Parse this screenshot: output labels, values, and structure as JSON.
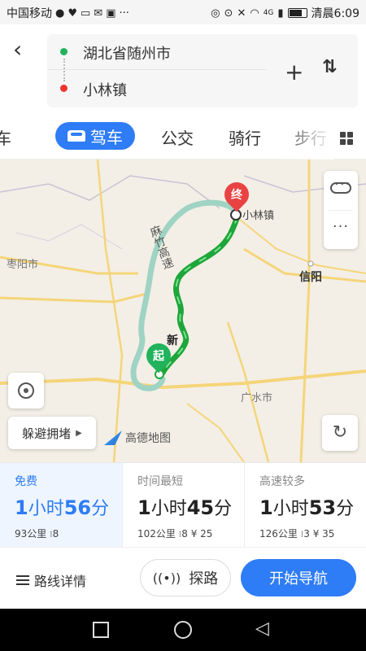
{
  "status_bar": {
    "carrier": "中国移动",
    "time_label": "清晨6:09",
    "network": "4G"
  },
  "search": {
    "origin": "湖北省随州市",
    "destination": "小林镇"
  },
  "modes": {
    "tab_partial_left": "车",
    "tab_drive": "驾车",
    "tab_bus": "公交",
    "tab_ride": "骑行",
    "tab_partial_right": "步行"
  },
  "map": {
    "labels": {
      "zaoyang": "枣阳市",
      "xinyang": "信阳",
      "guangshui": "广水市",
      "xiaolin": "小林镇",
      "expressway": "麻竹高速",
      "road": "新"
    },
    "end_pin": "终",
    "start_pin": "起",
    "avoid_congestion": "躲避拥堵",
    "logo_text": "高德地图"
  },
  "plans": [
    {
      "tag": "免费",
      "time_num1": "1",
      "time_unit1": "小时",
      "time_num2": "56",
      "time_unit2": "分",
      "distance": "93公里",
      "lights": "8",
      "toll": ""
    },
    {
      "tag": "时间最短",
      "time_num1": "1",
      "time_unit1": "小时",
      "time_num2": "45",
      "time_unit2": "分",
      "distance": "102公里",
      "lights": "8",
      "toll": "¥ 25"
    },
    {
      "tag": "高速较多",
      "time_num1": "1",
      "time_unit1": "小时",
      "time_num2": "53",
      "time_unit2": "分",
      "distance": "126公里",
      "lights": "3",
      "toll": "¥ 35"
    }
  ],
  "bottom": {
    "route_detail": "路线详情",
    "explore": "探路",
    "start_navigation": "开始导航"
  },
  "colors": {
    "accent": "#2e7cf6",
    "route_green": "#1ea63b",
    "route_alt": "#9fd3c4",
    "end_red": "#e94242"
  }
}
